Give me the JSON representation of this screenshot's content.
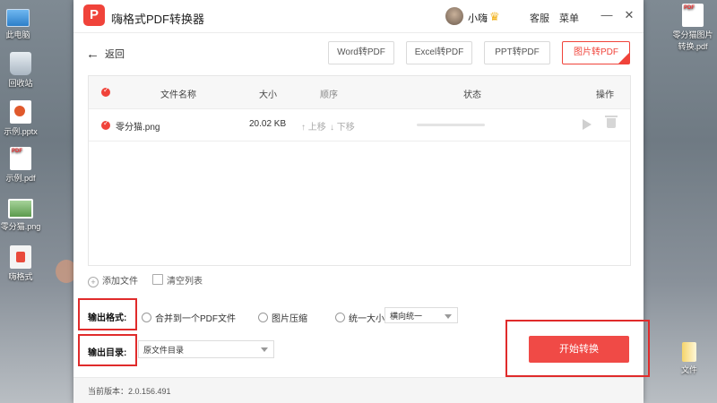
{
  "desktop": {
    "icons": [
      {
        "label": "此电脑",
        "icon": "computer-icon"
      },
      {
        "label": "回收站",
        "icon": "recycle-bin-icon"
      },
      {
        "label": "示例.pptx",
        "icon": "pptx-file-icon"
      },
      {
        "label": "示例.pdf",
        "icon": "pdf-file-icon"
      },
      {
        "label": "零分猫.png",
        "icon": "png-file-icon"
      },
      {
        "label": "嗨格式",
        "icon": "app-shortcut-icon"
      },
      {
        "label": "零分猫图片转换.pdf",
        "icon": "pdf-file-icon"
      },
      {
        "label": "文件",
        "icon": "zip-file-icon"
      }
    ]
  },
  "app": {
    "logo_text": "P",
    "title": "嗨格式PDF转换器",
    "user": "小嗨",
    "support": "客服",
    "menu": "菜单",
    "minimize": "—",
    "close": "✕"
  },
  "nav": {
    "back": "返回"
  },
  "tabs": [
    {
      "label": "Word转PDF",
      "active": false
    },
    {
      "label": "Excel转PDF",
      "active": false
    },
    {
      "label": "PPT转PDF",
      "active": false
    },
    {
      "label": "图片转PDF",
      "active": true
    }
  ],
  "table": {
    "headers": {
      "name": "文件名称",
      "size": "大小",
      "order": "顺序",
      "status": "状态",
      "actions": "操作"
    },
    "rows": [
      {
        "name": "零分猫.png",
        "size": "20.02 KB",
        "up": "上移",
        "down": "下移"
      }
    ]
  },
  "list_actions": {
    "add": "添加文件",
    "clear": "清空列表"
  },
  "output": {
    "format_label": "输出格式:",
    "merge": "合并到一个PDF文件",
    "compress": "图片压缩",
    "uniform": "统一大小:",
    "uniform_select": "横向统一",
    "dir_label": "输出目录:",
    "dir_select": "原文件目录"
  },
  "start": "开始转换",
  "footer": {
    "version": "当前版本：2.0.156.491"
  },
  "colors": {
    "accent": "#f0433a",
    "highlight": "#e02b2b"
  }
}
